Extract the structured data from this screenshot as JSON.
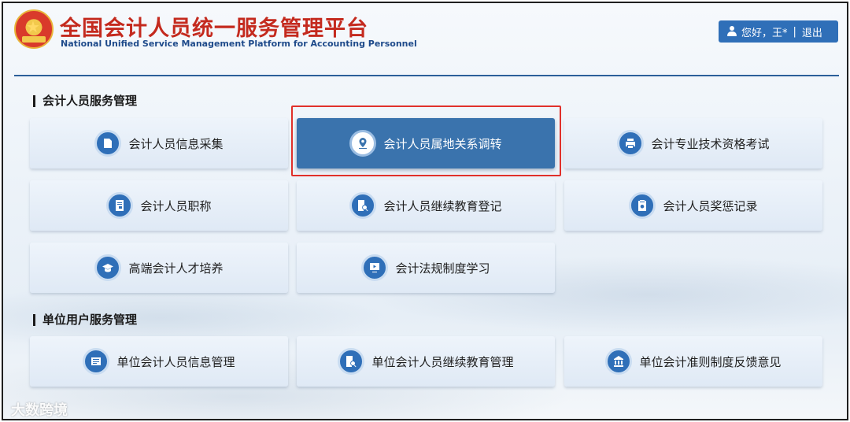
{
  "header": {
    "title_cn": "全国会计人员统一服务管理平台",
    "title_en": "National Unified Service Management Platform for Accounting Personnel",
    "user": {
      "greeting": "您好，王*",
      "separator": "|",
      "logout_label": "退出"
    }
  },
  "sections": [
    {
      "title": "会计人员服务管理",
      "items": [
        {
          "label": "会计人员信息采集",
          "icon": "edit-doc-icon"
        },
        {
          "label": "会计人员属地关系调转",
          "icon": "location-pin-icon",
          "active": true
        },
        {
          "label": "会计专业技术资格考试",
          "icon": "printer-icon"
        },
        {
          "label": "会计人员职称",
          "icon": "certificate-icon"
        },
        {
          "label": "会计人员继续教育登记",
          "icon": "doc-search-icon"
        },
        {
          "label": "会计人员奖惩记录",
          "icon": "clipboard-search-icon"
        },
        {
          "label": "高端会计人才培养",
          "icon": "graduation-cap-icon"
        },
        {
          "label": "会计法规制度学习",
          "icon": "video-play-icon"
        }
      ]
    },
    {
      "title": "单位用户服务管理",
      "items": [
        {
          "label": "单位会计人员信息管理",
          "icon": "id-card-icon"
        },
        {
          "label": "单位会计人员继续教育管理",
          "icon": "doc-search-icon"
        },
        {
          "label": "单位会计准则制度反馈意见",
          "icon": "building-icon"
        }
      ]
    }
  ],
  "watermark": "大数跨境",
  "colors": {
    "title_red": "#c42a1e",
    "primary_blue": "#2f6fb8",
    "active_card": "#3a73ad",
    "highlight_red": "#e0302a"
  }
}
